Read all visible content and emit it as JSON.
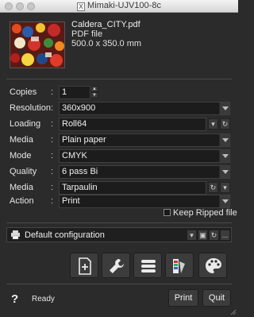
{
  "window": {
    "title": "Mimaki-UJV100-8c"
  },
  "file": {
    "name": "Caldera_CITY.pdf",
    "type": "PDF file",
    "size": "500.0 x 350.0 mm"
  },
  "settings": {
    "copies": {
      "label": "Copies",
      "value": "1"
    },
    "resolution": {
      "label": "Resolution",
      "value": "360x900"
    },
    "loading": {
      "label": "Loading",
      "value": "Roll64"
    },
    "media": {
      "label": "Media",
      "value": "Plain paper"
    },
    "mode": {
      "label": "Mode",
      "value": "CMYK"
    },
    "quality": {
      "label": "Quality",
      "value": "6 pass Bi"
    },
    "media2": {
      "label": "Media",
      "value": "Tarpaulin"
    },
    "action": {
      "label": "Action",
      "value": "Print"
    },
    "colon": ":"
  },
  "keep_ripped": {
    "label": "Keep Ripped file",
    "checked": false
  },
  "config": {
    "value": "Default configuration",
    "more": "..."
  },
  "tools": [
    "add-page-icon",
    "wrench-icon",
    "list-icon",
    "color-swatch-icon",
    "palette-icon"
  ],
  "footer": {
    "help": "?",
    "status": "Ready",
    "print": "Print",
    "quit": "Quit"
  }
}
